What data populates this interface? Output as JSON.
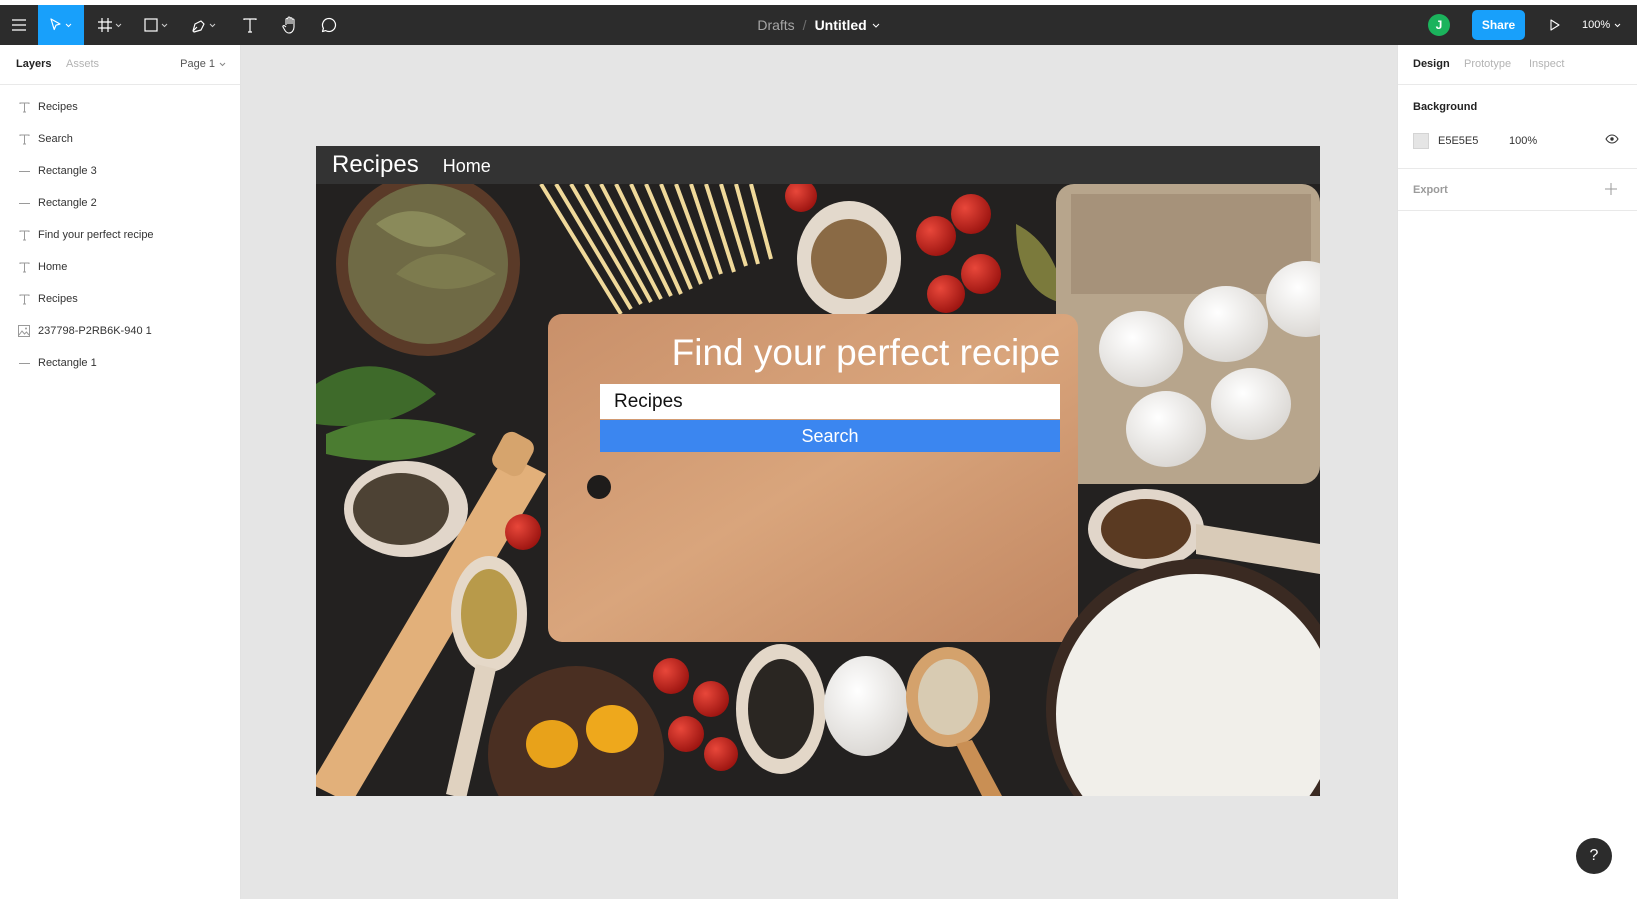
{
  "toolbar": {
    "menu_icon": "hamburger-icon",
    "tools": [
      "move-tool-icon",
      "frame-tool-icon",
      "rectangle-tool-icon",
      "pen-tool-icon",
      "text-tool-icon",
      "hand-tool-icon",
      "comment-tool-icon"
    ],
    "active_tool": "move",
    "accent": "#18a0fb",
    "breadcrumb": {
      "folder": "Drafts",
      "separator": "/",
      "file": "Untitled"
    },
    "avatar_initial": "J",
    "avatar_color": "#1bb35c",
    "share_label": "Share",
    "zoom": "100%"
  },
  "left_panel": {
    "tabs": [
      "Layers",
      "Assets"
    ],
    "active_tab": "Layers",
    "page": "Page 1",
    "layers": [
      {
        "type": "text",
        "name": "Recipes"
      },
      {
        "type": "text",
        "name": "Search"
      },
      {
        "type": "rectangle",
        "name": "Rectangle 3"
      },
      {
        "type": "rectangle",
        "name": "Rectangle 2"
      },
      {
        "type": "text",
        "name": "Find your perfect recipe"
      },
      {
        "type": "text",
        "name": "Home"
      },
      {
        "type": "text",
        "name": "Recipes"
      },
      {
        "type": "image",
        "name": "237798-P2RB6K-940 1"
      },
      {
        "type": "rectangle",
        "name": "Rectangle 1"
      }
    ]
  },
  "right_panel": {
    "tabs": [
      "Design",
      "Prototype",
      "Inspect"
    ],
    "active_tab": "Design",
    "background": {
      "title": "Background",
      "hex": "E5E5E5",
      "opacity": "100%"
    },
    "export": {
      "title": "Export"
    }
  },
  "canvas": {
    "background": "#e5e5e5",
    "frame": {
      "brand": "Recipes",
      "nav_link": "Home",
      "hero_title": "Find your perfect recipe",
      "search_value": "Recipes",
      "search_button": "Search",
      "button_color": "#3b86f0"
    }
  },
  "help_label": "?"
}
